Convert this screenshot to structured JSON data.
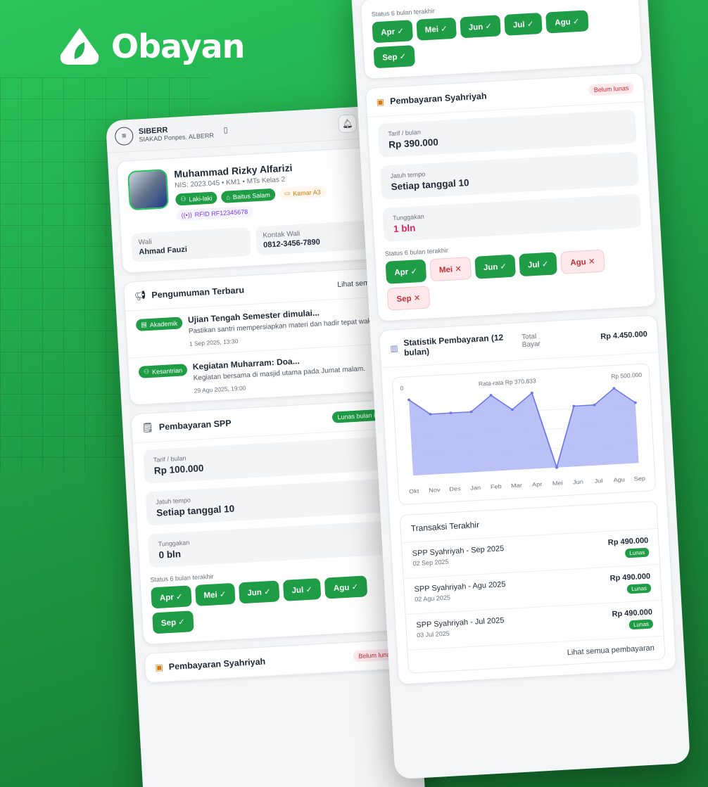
{
  "brand": {
    "name": "Obayan"
  },
  "app": {
    "title": "SIBERR",
    "subtitle": "SIAKAD Ponpes. ALBERR"
  },
  "profile": {
    "name": "Muhammad Rizky Alfarizi",
    "nis": "NIS: 2023.045 • KM1 • MTs Kelas 2",
    "tags": [
      "Laki-laki",
      "Baitus Salam",
      "Kamar A3",
      "RFID RF12345678"
    ],
    "wali_label": "Wali",
    "wali": "Ahmad Fauzi",
    "kontak_label": "Kontak Wali",
    "kontak": "0812-3456-7890"
  },
  "announcements": {
    "title": "Pengumuman Terbaru",
    "link": "Lihat semua",
    "items": [
      {
        "tag": "Akademik",
        "title": "Ujian Tengah Semester dimulai...",
        "desc": "Pastikan santri mempersiapkan materi dan hadir tepat waktu.",
        "date": "1 Sep 2025, 13:30"
      },
      {
        "tag": "Kesantrian",
        "title": "Kegiatan Muharram: Doa...",
        "desc": "Kegiatan bersama di masjid utama pada Jumat malam.",
        "date": "29 Agu 2025, 19:00"
      }
    ]
  },
  "spp": {
    "title": "Pembayaran SPP",
    "badge": "Lunas bulan ini",
    "tarif_label": "Tarif / bulan",
    "tarif": "Rp 100.000",
    "jatuh_label": "Jatuh tempo",
    "jatuh": "Setiap tanggal 10",
    "tunggakan_label": "Tunggakan",
    "tunggakan": "0 bln",
    "status_label": "Status 6 bulan terakhir",
    "months": [
      {
        "m": "Apr",
        "s": "✓",
        "ok": true
      },
      {
        "m": "Mei",
        "s": "✓",
        "ok": true
      },
      {
        "m": "Jun",
        "s": "✓",
        "ok": true
      },
      {
        "m": "Jul",
        "s": "✓",
        "ok": true
      },
      {
        "m": "Agu",
        "s": "✓",
        "ok": true
      },
      {
        "m": "Sep",
        "s": "✓",
        "ok": true
      }
    ]
  },
  "syahriyah_left": {
    "title": "Pembayaran Syahriyah",
    "badge": "Belum lunas"
  },
  "right_top": {
    "status_label": "Status 6 bulan terakhir",
    "months": [
      {
        "m": "Apr",
        "s": "✓",
        "ok": true
      },
      {
        "m": "Mei",
        "s": "✓",
        "ok": true
      },
      {
        "m": "Jun",
        "s": "✓",
        "ok": true
      },
      {
        "m": "Jul",
        "s": "✓",
        "ok": true
      },
      {
        "m": "Agu",
        "s": "✓",
        "ok": true
      },
      {
        "m": "Sep",
        "s": "✓",
        "ok": true
      }
    ]
  },
  "syahriyah": {
    "title": "Pembayaran Syahriyah",
    "badge": "Belum lunas",
    "tarif_label": "Tarif / bulan",
    "tarif": "Rp 390.000",
    "jatuh_label": "Jatuh tempo",
    "jatuh": "Setiap tanggal 10",
    "tunggakan_label": "Tunggakan",
    "tunggakan": "1 bln",
    "status_label": "Status 6 bulan terakhir",
    "months": [
      {
        "m": "Apr",
        "s": "✓",
        "ok": true
      },
      {
        "m": "Mei",
        "s": "✕",
        "ok": false
      },
      {
        "m": "Jun",
        "s": "✓",
        "ok": true
      },
      {
        "m": "Jul",
        "s": "✓",
        "ok": true
      },
      {
        "m": "Agu",
        "s": "✕",
        "ok": false
      },
      {
        "m": "Sep",
        "s": "✕",
        "ok": false
      }
    ]
  },
  "stats": {
    "title": "Statistik Pembayaran (12 bulan)",
    "total_label": "Total Bayar",
    "total": "Rp 4.450.000",
    "axis_min": "0",
    "avg_label": "Rata-rata Rp 370.833",
    "axis_max": "Rp 500.000"
  },
  "chart_data": {
    "type": "area",
    "categories": [
      "Okt",
      "Nov",
      "Des",
      "Jan",
      "Feb",
      "Mar",
      "Apr",
      "Mei",
      "Jun",
      "Jul",
      "Agu",
      "Sep"
    ],
    "values": [
      490000,
      390000,
      390000,
      390000,
      490000,
      390000,
      490000,
      0,
      390000,
      390000,
      490000,
      390000
    ],
    "ylim": [
      0,
      500000
    ],
    "color": "#6d78e8"
  },
  "transactions": {
    "title": "Transaksi Terakhir",
    "items": [
      {
        "name": "SPP Syahriyah - Sep 2025",
        "date": "02 Sep 2025",
        "amount": "Rp 490.000",
        "status": "Lunas"
      },
      {
        "name": "SPP Syahriyah - Agu 2025",
        "date": "02 Agu 2025",
        "amount": "Rp 490.000",
        "status": "Lunas"
      },
      {
        "name": "SPP Syahriyah - Jul 2025",
        "date": "03 Jul 2025",
        "amount": "Rp 490.000",
        "status": "Lunas"
      }
    ],
    "footer": "Lihat semua pembayaran"
  }
}
